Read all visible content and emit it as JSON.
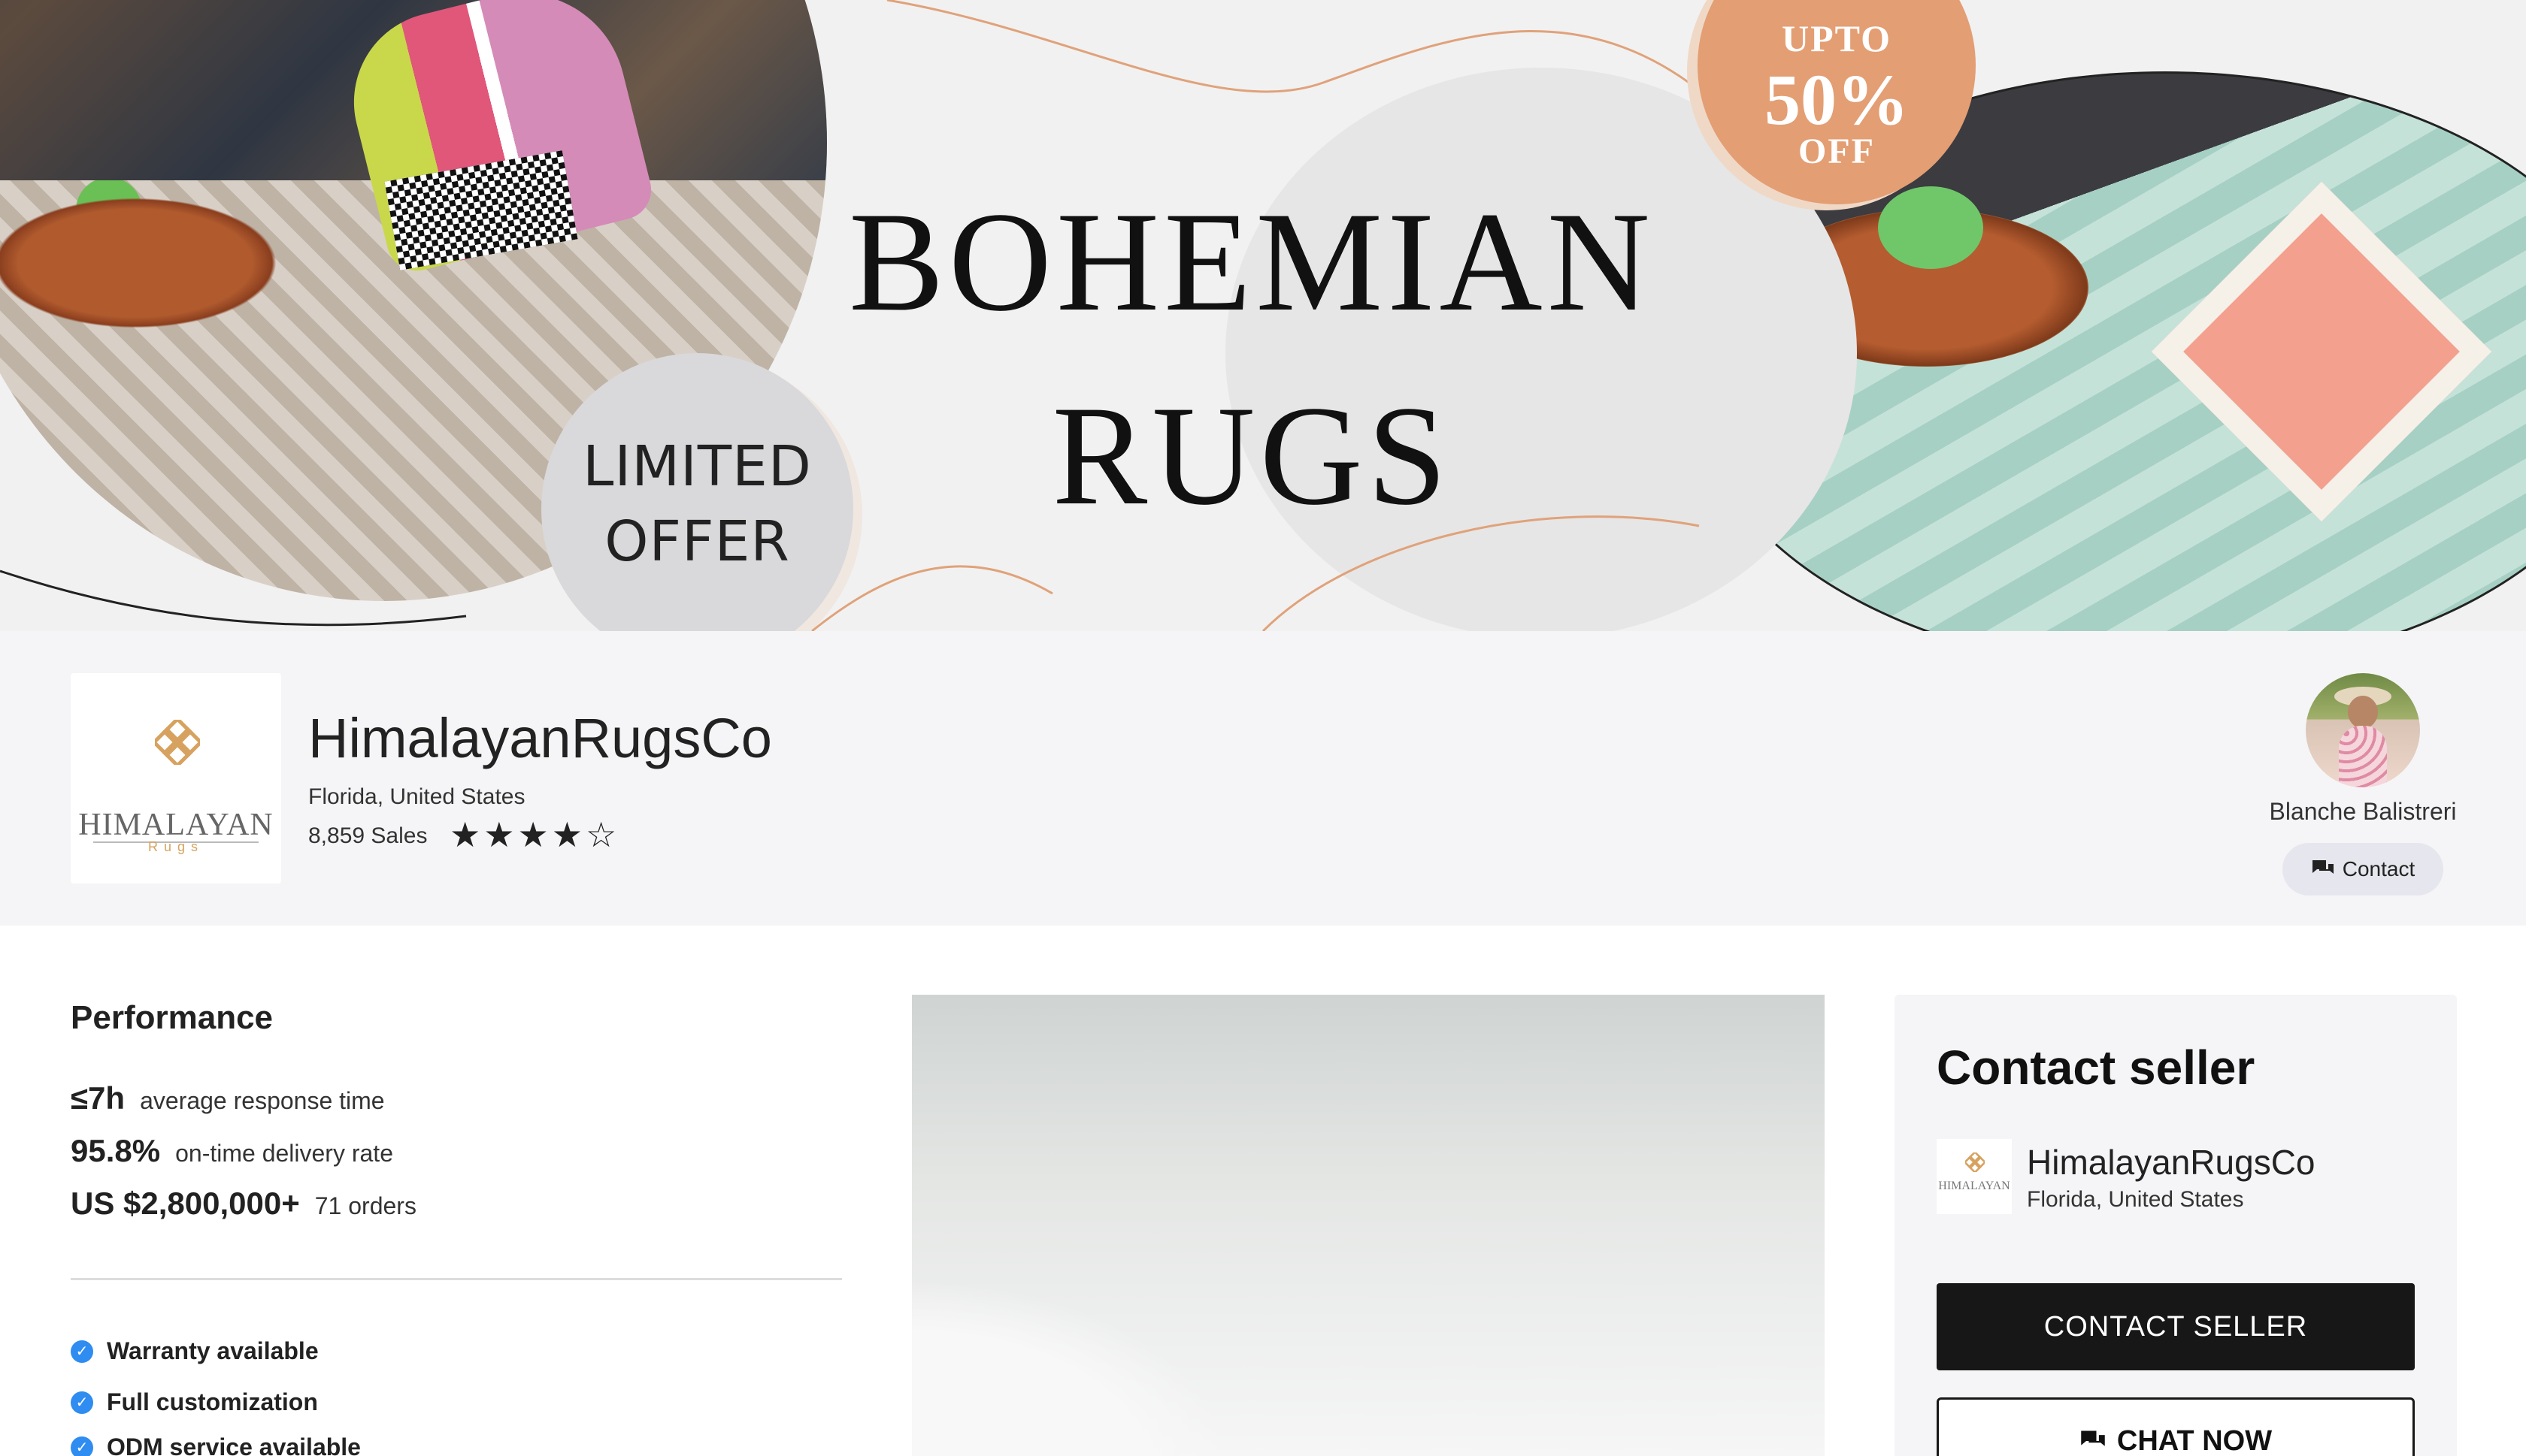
{
  "banner": {
    "headline_line1": "BOHEMIAN",
    "headline_line2": "RUGS",
    "badge_line1": "LIMITED",
    "badge_line2": "OFFER",
    "promo_line1": "UPTO",
    "promo_line2": "50%",
    "promo_line3": "OFF",
    "colors": {
      "promo": "#e39e73",
      "badge": "#d9d8da",
      "curve": "#e0a27a"
    }
  },
  "store": {
    "logo_wordmark": "HIMALAYAN",
    "logo_sub": "Rugs",
    "name": "HimalayanRugsCo",
    "location": "Florida, United States",
    "sales": "8,859 Sales",
    "rating": 4,
    "rating_max": 5,
    "stars": [
      "★",
      "★",
      "★",
      "★",
      "☆"
    ]
  },
  "seller": {
    "name": "Blanche Balistreri",
    "contact_label": "Contact",
    "contact_icon": "chat-bubbles-icon"
  },
  "performance": {
    "title": "Performance",
    "metrics": [
      {
        "value": "≤7h",
        "label": "average response time"
      },
      {
        "value": "95.8%",
        "label": "on-time delivery rate"
      },
      {
        "value": "US $2,800,000+",
        "label": "71 orders"
      }
    ],
    "features": [
      "Warranty available",
      "Full customization",
      "ODM service available"
    ],
    "feature_icon": "verified-check-icon",
    "accent": "#2f8cf0"
  },
  "contact_card": {
    "title": "Contact seller",
    "store_name": "HimalayanRugsCo",
    "store_location": "Florida, United States",
    "mini_logo_word": "HIMALAYAN",
    "primary_button": "CONTACT SELLER",
    "secondary_button": "CHAT NOW",
    "secondary_icon": "chat-bubbles-icon"
  }
}
